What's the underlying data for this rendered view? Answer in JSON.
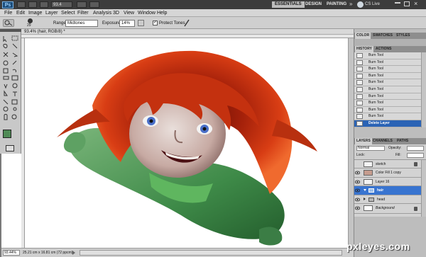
{
  "appbar": {
    "logo": "Ps",
    "zoom": "93.4",
    "workspaces": [
      "ESSENTIALS",
      "DESIGN",
      "PAINTING"
    ],
    "more": "»",
    "cslive": "CS Live"
  },
  "menu": [
    "File",
    "Edit",
    "Image",
    "Layer",
    "Select",
    "Filter",
    "Analysis",
    "3D",
    "View",
    "Window",
    "Help"
  ],
  "options": {
    "brush_size": "29",
    "range_label": "Range:",
    "range_value": "Midtones",
    "exposure_label": "Exposure:",
    "exposure_value": "14%",
    "protect_tones": "Protect Tones"
  },
  "document": {
    "tab_title": "93.4% (hair, RGB/8) *",
    "zoom": "93.44%",
    "status": "25.21 cm x 16.81 cm (72 ppcm)"
  },
  "panels": {
    "top_tabs": [
      "COLOR",
      "SWATCHES",
      "STYLES"
    ],
    "history_tabs": [
      "HISTORY",
      "ACTIONS"
    ],
    "history_items": [
      "Burn Tool",
      "Burn Tool",
      "Burn Tool",
      "Burn Tool",
      "Burn Tool",
      "Burn Tool",
      "Burn Tool",
      "Burn Tool",
      "Burn Tool",
      "Burn Tool",
      "Delete Layer"
    ],
    "layers_tabs": [
      "LAYERS",
      "CHANNELS",
      "PATHS"
    ],
    "blend_mode": "Normal",
    "opacity_label": "Opacity:",
    "lock_label": "Lock:",
    "fill_label": "Fill:",
    "layers": [
      {
        "name": "sketch",
        "selected": false
      },
      {
        "name": "Color Fill 1 copy",
        "selected": false
      },
      {
        "name": "Layer 16",
        "selected": false
      },
      {
        "name": "hair",
        "selected": true
      },
      {
        "name": "head",
        "selected": false
      },
      {
        "name": "Background",
        "selected": false
      }
    ]
  },
  "watermark": "pxleyes.com"
}
